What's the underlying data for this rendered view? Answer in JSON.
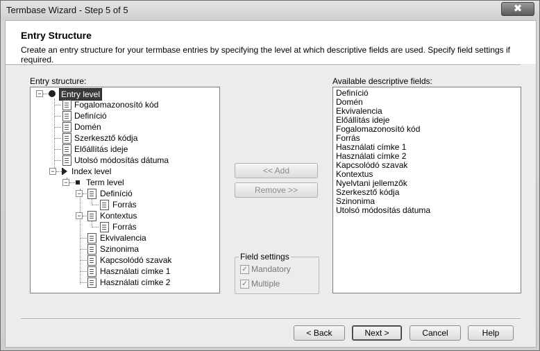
{
  "window": {
    "title": "Termbase Wizard - Step 5 of 5",
    "close_glyph": "✖"
  },
  "header": {
    "title": "Entry Structure",
    "description": "Create an entry structure for your termbase entries by specifying the level at which descriptive fields are used. Specify field settings if required."
  },
  "entry_structure": {
    "label": "Entry structure:",
    "entry_level": "Entry level",
    "entry_fields": [
      "Fogalomazonosító kód",
      "Definíció",
      "Domén",
      "Szerkesztő kódja",
      "Előállítás ideje",
      "Utolsó módosítás dátuma"
    ],
    "index_level": "Index level",
    "term_level": "Term level",
    "definicio": "Definíció",
    "definicio_child": "Forrás",
    "kontextus": "Kontextus",
    "kontextus_child": "Forrás",
    "term_fields": [
      "Ekvivalencia",
      "Szinonima",
      "Kapcsolódó szavak",
      "Használati címke 1",
      "Használati címke 2"
    ]
  },
  "available": {
    "label": "Available descriptive fields:",
    "items": [
      "Definíció",
      "Domén",
      "Ekvivalencia",
      "Előállítás ideje",
      "Fogalomazonosító kód",
      "Forrás",
      "Használati címke 1",
      "Használati címke 2",
      "Kapcsolódó szavak",
      "Kontextus",
      "Nyelvtani jellemzők",
      "Szerkesztő kódja",
      "Szinonima",
      "Utolsó módosítás dátuma"
    ]
  },
  "buttons": {
    "add": "<< Add",
    "remove": "Remove >>",
    "back": "< Back",
    "next": "Next >",
    "cancel": "Cancel",
    "help": "Help"
  },
  "field_settings": {
    "label": "Field settings",
    "mandatory": "Mandatory",
    "multiple": "Multiple",
    "check_glyph": "✓"
  }
}
